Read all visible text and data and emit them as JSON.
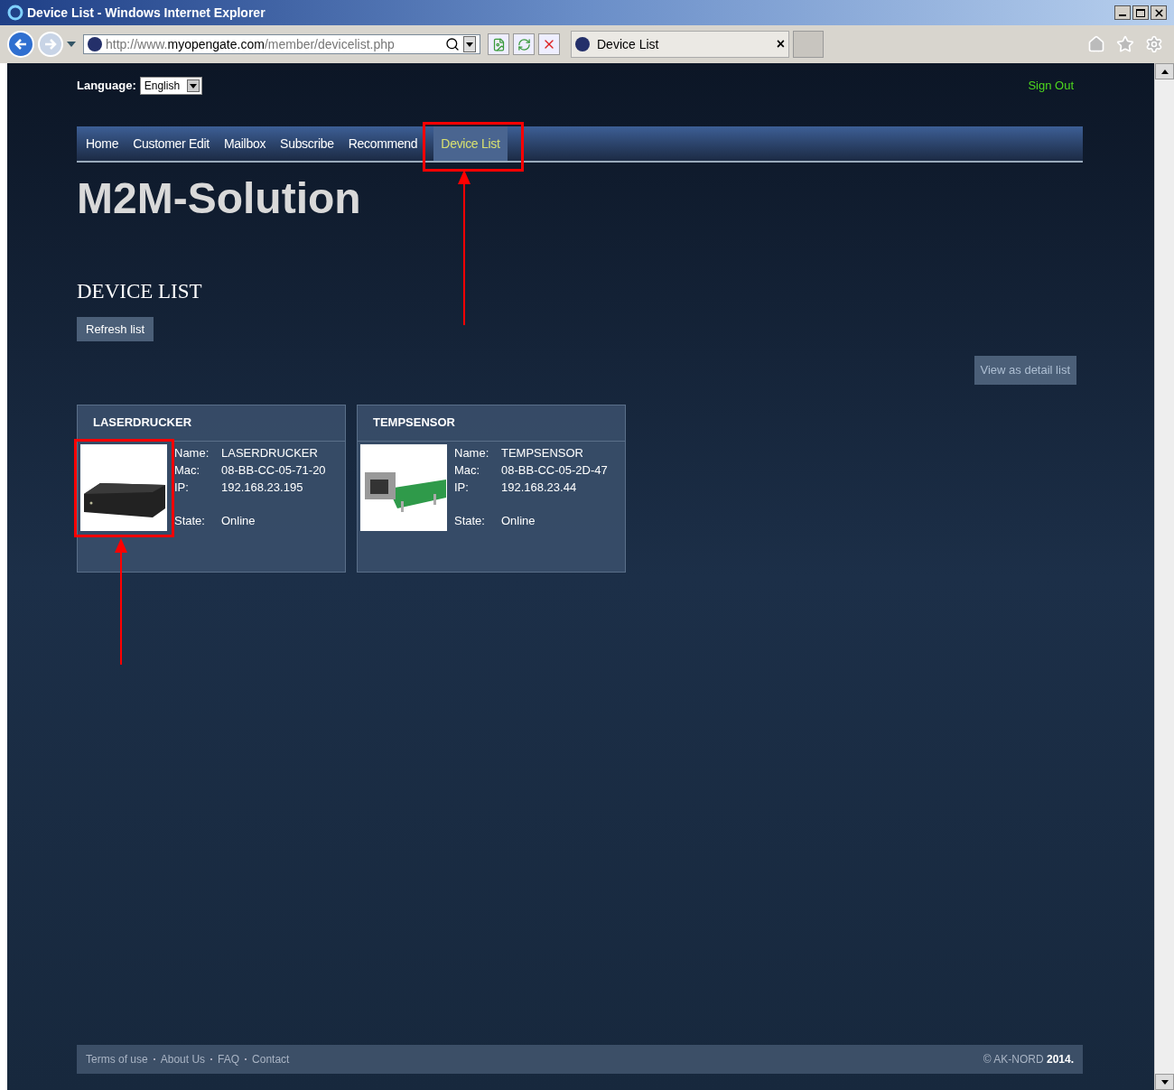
{
  "window": {
    "title": "Device List - Windows Internet Explorer"
  },
  "address": {
    "url": "http://www.**myopengate.com**/member/devicelist.php"
  },
  "browser_tab": {
    "title": "Device List",
    "close": "×"
  },
  "language": {
    "label": "Language:",
    "value": "English"
  },
  "sign_out": "Sign Out",
  "nav": [
    {
      "label": "Home",
      "selected": false
    },
    {
      "label": "Customer Edit",
      "selected": false
    },
    {
      "label": "Mailbox",
      "selected": false
    },
    {
      "label": "Subscribe",
      "selected": false
    },
    {
      "label": "Recommend",
      "selected": false
    },
    {
      "label": "Device List",
      "selected": true
    }
  ],
  "logo": "M2M-Solution",
  "heading": "DEVICE LIST",
  "refresh_button": "Refresh list",
  "detail_button": "View as detail list",
  "devices": [
    {
      "title": "LASERDRUCKER",
      "kind": "box",
      "fields": [
        {
          "label": "Name:",
          "value": "LASERDRUCKER"
        },
        {
          "label": "Mac:",
          "value": "08-BB-CC-05-71-20"
        },
        {
          "label": "IP:",
          "value": "192.168.23.195"
        }
      ],
      "state_label": "State:",
      "state": "Online"
    },
    {
      "title": "TEMPSENSOR",
      "kind": "board",
      "fields": [
        {
          "label": "Name:",
          "value": "TEMPSENSOR"
        },
        {
          "label": "Mac:",
          "value": "08-BB-CC-05-2D-47"
        },
        {
          "label": "IP:",
          "value": "192.168.23.44"
        }
      ],
      "state_label": "State:",
      "state": "Online"
    }
  ],
  "footer": {
    "links": [
      "Terms of use",
      "About Us",
      "FAQ",
      "Contact"
    ],
    "copyright": "© AK-NORD **2014.**"
  }
}
